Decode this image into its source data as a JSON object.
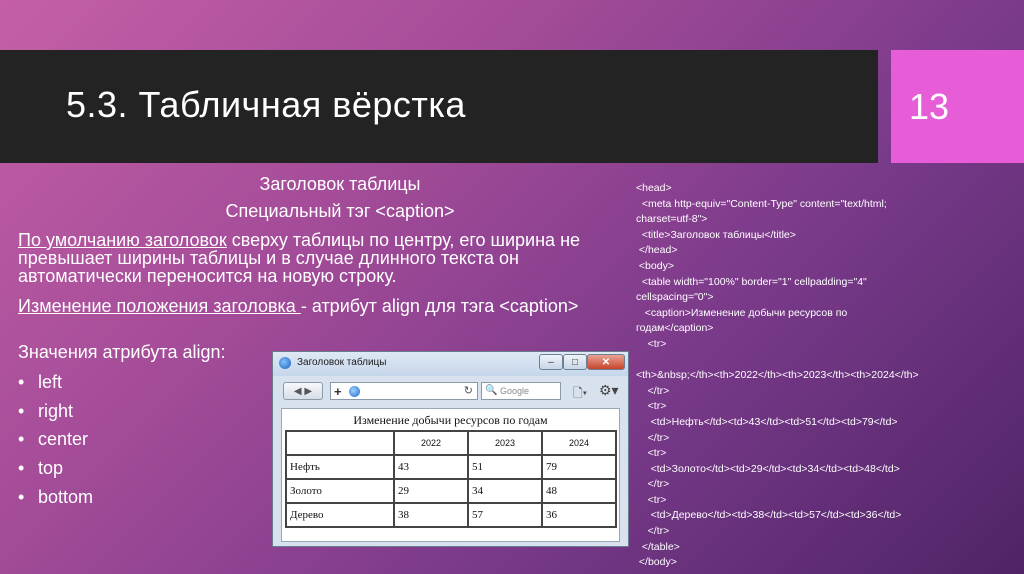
{
  "slide": {
    "title": "5.3. Табличная вёрстка",
    "number": "13"
  },
  "left": {
    "caption_line1": "Заголовок таблицы",
    "caption_line2": "Специальный тэг <caption>",
    "p1_underlined": "По умолчанию заголовок",
    "p1_rest": " сверху таблицы по центру, его ширина не превышает ширины таблицы и в случае длинного текста он автоматически переносится на новую строку.",
    "p2_underlined": "Изменение положения заголовка ",
    "p2_rest": "- атрибут align для тэга <caption>",
    "p3": "Значения атрибута align:",
    "align_values": [
      "left",
      "right",
      "center",
      "top",
      "bottom"
    ]
  },
  "code_lines": [
    "<head>",
    "  <meta http-equiv=\"Content-Type\" content=\"text/html;",
    "charset=utf-8\">",
    "  <title>Заголовок таблицы</title>",
    " </head>",
    " <body>",
    "  <table width=\"100%\" border=\"1\" cellpadding=\"4\"",
    "cellspacing=\"0\">",
    "   <caption>Изменение добычи ресурсов по",
    "годам</caption>",
    "    <tr>",
    "",
    "<th>&nbsp;</th><th>2022</th><th>2023</th><th>2024</th>",
    "    </tr>",
    "    <tr>",
    "     <td>Нефть</td><td>43</td><td>51</td><td>79</td>",
    "    </tr>",
    "    <tr>",
    "     <td>Золото</td><td>29</td><td>34</td><td>48</td>",
    "    </tr>",
    "    <tr>",
    "     <td>Дерево</td><td>38</td><td>57</td><td>36</td>",
    "    </tr>",
    "  </table>",
    " </body>"
  ],
  "browser": {
    "window_title": "Заголовок таблицы",
    "search_placeholder": "Google",
    "btn_min": "–",
    "btn_max": "□",
    "btn_close": "✕",
    "nav_back": "◀ ▶",
    "addr_plus": "+",
    "addr_refresh": "↻",
    "search_glyph": "🔍",
    "page_glyph": "🗋▾",
    "gear_glyph": "⚙▾",
    "table_caption": "Изменение добычи ресурсов по годам",
    "headers": [
      "",
      "2022",
      "2023",
      "2024"
    ],
    "rows": [
      [
        "Нефть",
        "43",
        "51",
        "79"
      ],
      [
        "Золото",
        "29",
        "34",
        "48"
      ],
      [
        "Дерево",
        "38",
        "57",
        "36"
      ]
    ]
  }
}
